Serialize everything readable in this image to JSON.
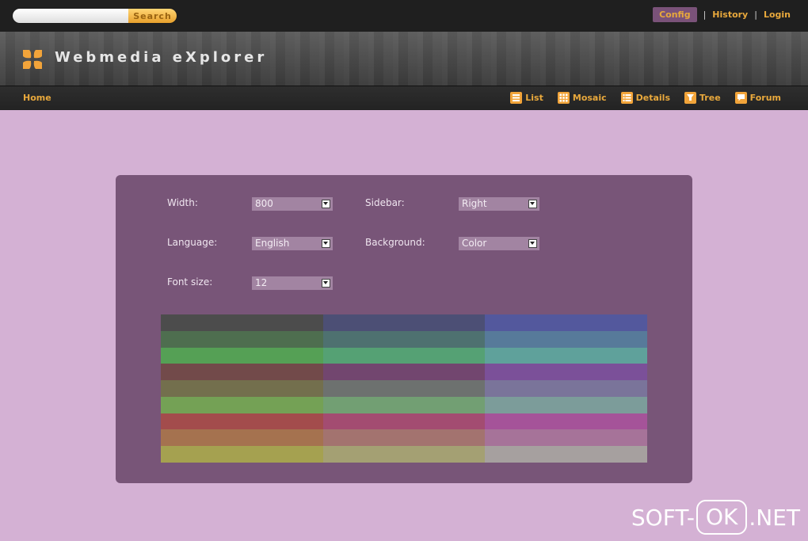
{
  "search": {
    "placeholder": "",
    "button_label": "Search"
  },
  "toplinks": {
    "config": "Config",
    "history": "History",
    "login": "Login",
    "separator": "|"
  },
  "header": {
    "title": "Webmedia eXplorer"
  },
  "nav": {
    "home": "Home",
    "items": [
      {
        "label": "List",
        "icon": "list-icon"
      },
      {
        "label": "Mosaic",
        "icon": "grid-icon"
      },
      {
        "label": "Details",
        "icon": "details-icon"
      },
      {
        "label": "Tree",
        "icon": "tree-icon"
      },
      {
        "label": "Forum",
        "icon": "forum-icon"
      }
    ]
  },
  "settings": {
    "width": {
      "label": "Width:",
      "value": "800"
    },
    "sidebar": {
      "label": "Sidebar:",
      "value": "Right"
    },
    "language": {
      "label": "Language:",
      "value": "English"
    },
    "background": {
      "label": "Background:",
      "value": "Color"
    },
    "font_size": {
      "label": "Font size:",
      "value": "12"
    }
  },
  "palette": [
    [
      "#4c4c4c",
      "#4c4f75",
      "#53589d"
    ],
    [
      "#4e6e4f",
      "#4e7170",
      "#577a9a"
    ],
    [
      "#55a055",
      "#55a174",
      "#5fa19b"
    ],
    [
      "#724a4a",
      "#72466f",
      "#7b5099"
    ],
    [
      "#736f4d",
      "#6d716f",
      "#7a749a"
    ],
    [
      "#74a155",
      "#729f73",
      "#7c9c9a"
    ],
    [
      "#a34c4c",
      "#a34c71",
      "#a55399"
    ],
    [
      "#a5724f",
      "#a3736f",
      "#a67399"
    ],
    [
      "#a5a150",
      "#a4a073",
      "#a6a09f"
    ]
  ],
  "watermark": {
    "left": "SOFT-",
    "middle": "OK",
    "right": ".NET"
  },
  "colors": {
    "accent": "#e8a83c",
    "page_bg": "#d4b1d4",
    "panel_bg": "#785578"
  }
}
